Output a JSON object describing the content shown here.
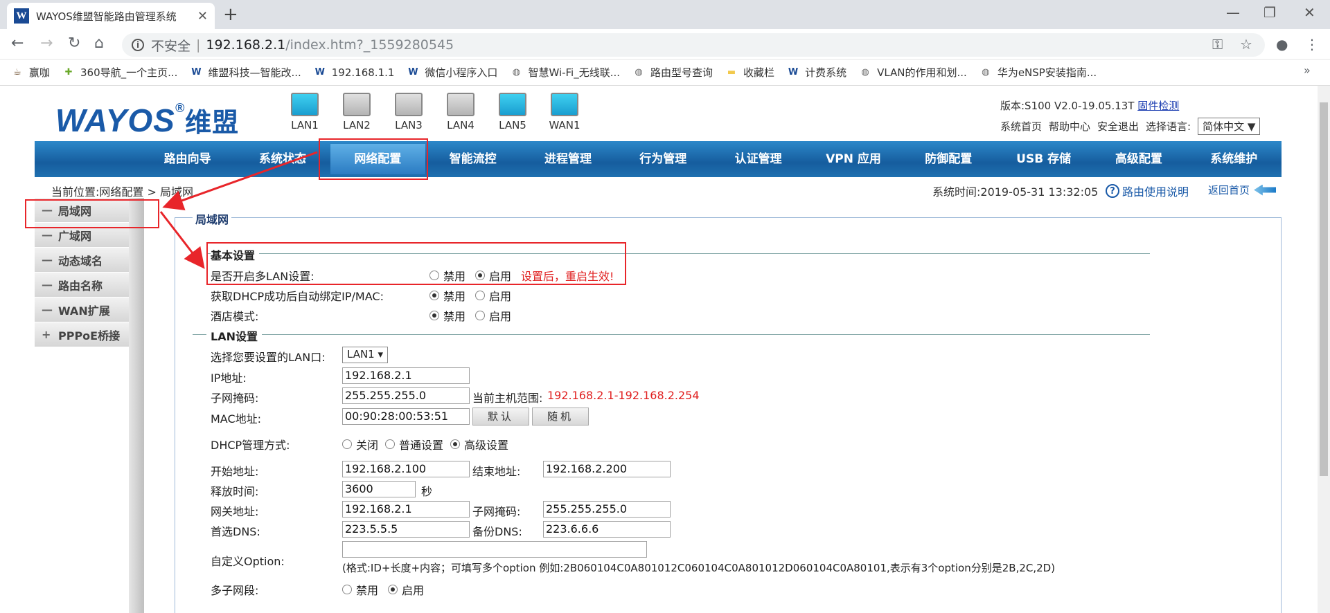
{
  "browser": {
    "tab_title": "WAYOS维盟智能路由管理系统",
    "url_security": "不安全",
    "url_host": "192.168.2.1",
    "url_path": "/index.htm?_1559280545",
    "bookmarks": [
      {
        "label": "赢咖",
        "icon": "coffee-icon"
      },
      {
        "label": "360导航_一个主页...",
        "icon": "360-icon"
      },
      {
        "label": "维盟科技—智能改...",
        "icon": "w-logo-icon"
      },
      {
        "label": "192.168.1.1",
        "icon": "w-logo-icon"
      },
      {
        "label": "微信小程序入口",
        "icon": "w-logo-icon"
      },
      {
        "label": "智慧Wi-Fi_无线联...",
        "icon": "globe-icon"
      },
      {
        "label": "路由型号查询",
        "icon": "globe-icon"
      },
      {
        "label": "收藏栏",
        "icon": "folder-icon"
      },
      {
        "label": "计费系统",
        "icon": "w-logo-icon"
      },
      {
        "label": "VLAN的作用和划...",
        "icon": "globe-icon"
      },
      {
        "label": "华为eNSP安装指南...",
        "icon": "globe-icon"
      }
    ]
  },
  "header": {
    "logo_text": "WAYOS",
    "logo_reg": "®",
    "logo_cn": "维盟",
    "ports": [
      {
        "label": "LAN1",
        "active": true
      },
      {
        "label": "LAN2",
        "active": false
      },
      {
        "label": "LAN3",
        "active": false
      },
      {
        "label": "LAN4",
        "active": false
      },
      {
        "label": "LAN5",
        "active": true
      },
      {
        "label": "WAN1",
        "active": true
      }
    ],
    "version_label": "版本:S100 V2.0-19.05.13T",
    "firmware_check": "固件检测",
    "links": [
      "系统首页",
      "帮助中心",
      "安全退出"
    ],
    "lang_label": "选择语言:",
    "lang_value": "简体中文 ▼"
  },
  "menu": [
    "路由向导",
    "系统状态",
    "网络配置",
    "智能流控",
    "进程管理",
    "行为管理",
    "认证管理",
    "VPN 应用",
    "防御配置",
    "USB 存储",
    "高级配置",
    "系统维护"
  ],
  "menu_active": "网络配置",
  "breadcrumb": "当前位置:网络配置 > 局域网",
  "system_time": "系统时间:2019-05-31 13:32:05",
  "help_link": "路由使用说明",
  "home_link": "返回首页",
  "sidebar": [
    {
      "label": "局域网",
      "sign": "—"
    },
    {
      "label": "广域网",
      "sign": "—"
    },
    {
      "label": "动态域名",
      "sign": "—"
    },
    {
      "label": "路由名称",
      "sign": "—"
    },
    {
      "label": "WAN扩展",
      "sign": "—"
    },
    {
      "label": "PPPoE桥接",
      "sign": "+"
    }
  ],
  "content": {
    "title": "局域网",
    "basic": {
      "title": "基本设置",
      "multi_lan_label": "是否开启多LAN设置:",
      "dhcp_bind_label": "获取DHCP成功后自动绑定IP/MAC:",
      "hotel_label": "酒店模式:",
      "disable": "禁用",
      "enable": "启用",
      "restart_note": "设置后，重启生效!"
    },
    "lan": {
      "title": "LAN设置",
      "select_label": "选择您要设置的LAN口:",
      "select_value": "LAN1 ▾",
      "ip_label": "IP地址:",
      "ip_value": "192.168.2.1",
      "mask_label": "子网掩码:",
      "mask_value": "255.255.255.0",
      "range_label": "当前主机范围:",
      "range_value": "192.168.2.1-192.168.2.254",
      "mac_label": "MAC地址:",
      "mac_value": "00:90:28:00:53:51",
      "default_btn": "默认",
      "random_btn": "随机",
      "dhcp_label": "DHCP管理方式:",
      "dhcp_off": "关闭",
      "dhcp_normal": "普通设置",
      "dhcp_advanced": "高级设置",
      "start_label": "开始地址:",
      "start_value": "192.168.2.100",
      "end_label": "结束地址:",
      "end_value": "192.168.2.200",
      "lease_label": "释放时间:",
      "lease_value": "3600",
      "lease_unit": "秒",
      "gw_label": "网关地址:",
      "gw_value": "192.168.2.1",
      "gw_mask_label": "子网掩码:",
      "gw_mask_value": "255.255.255.0",
      "dns1_label": "首选DNS:",
      "dns1_value": "223.5.5.5",
      "dns2_label": "备份DNS:",
      "dns2_value": "223.6.6.6",
      "option_label": "自定义Option:",
      "option_value": "",
      "option_hint": "(格式:ID+长度+内容；可填写多个option 例如:2B060104C0A801012C060104C0A801012D060104C0A80101,表示有3个option分别是2B,2C,2D)",
      "subnet_label": "多子网段:"
    }
  }
}
